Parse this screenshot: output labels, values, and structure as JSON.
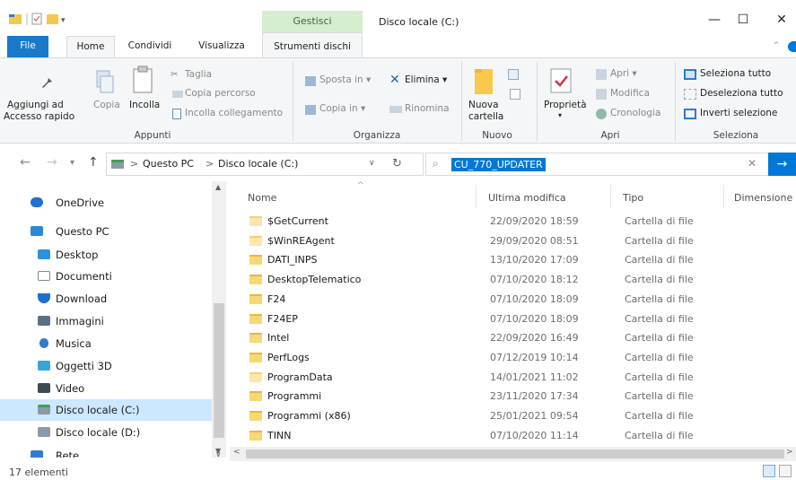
{
  "window": {
    "title": "Disco locale (C:)",
    "context_group": "Gestisci",
    "min_glyph": "—",
    "max_glyph": "☐",
    "close_glyph": "✕"
  },
  "tabs": [
    {
      "label": "File"
    },
    {
      "label": "Home"
    },
    {
      "label": "Condividi"
    },
    {
      "label": "Visualizza"
    },
    {
      "label": "Strumenti dischi"
    }
  ],
  "ribbon": {
    "appunti": {
      "pin_label_1": "Aggiungi ad",
      "pin_label_2": "Accesso rapido",
      "copy": "Copia",
      "paste": "Incolla",
      "cut": "Taglia",
      "copy_path": "Copia percorso",
      "paste_link": "Incolla collegamento",
      "group": "Appunti"
    },
    "organizza": {
      "move_to": "Sposta in ▾",
      "copy_to": "Copia in ▾",
      "delete": "Elimina ▾",
      "rename": "Rinomina",
      "group": "Organizza"
    },
    "nuovo": {
      "new_folder_1": "Nuova",
      "new_folder_2": "cartella",
      "group": "Nuovo"
    },
    "apri": {
      "properties": "Proprietà",
      "properties_arrow": "▾",
      "open": "Apri ▾",
      "edit": "Modifica",
      "history": "Cronologia",
      "group": "Apri"
    },
    "seleziona": {
      "select_all": "Seleziona tutto",
      "select_none": "Deseleziona tutto",
      "invert": "Inverti selezione",
      "group": "Seleziona"
    }
  },
  "address": {
    "segment_1": "Questo PC",
    "segment_2": "Disco locale (C:)",
    "separator": ">"
  },
  "search": {
    "value": "CU_770_UPDATER"
  },
  "nav": [
    {
      "label": "OneDrive",
      "color": "#1e6fd0"
    },
    {
      "label": "Questo PC",
      "color": "#2a8ad8"
    },
    {
      "label": "Desktop",
      "color": "#2f8fe0"
    },
    {
      "label": "Documenti",
      "color": "#7d8a96"
    },
    {
      "label": "Download",
      "color": "#1e6fd0"
    },
    {
      "label": "Immagini",
      "color": "#5a6f84"
    },
    {
      "label": "Musica",
      "color": "#2f7bd0"
    },
    {
      "label": "Oggetti 3D",
      "color": "#36a6d8"
    },
    {
      "label": "Video",
      "color": "#3d4a56"
    },
    {
      "label": "Disco locale (C:)",
      "color": "#8a9aa8"
    },
    {
      "label": "Disco locale (D:)",
      "color": "#8a9aa8"
    },
    {
      "label": "Rete",
      "color": "#2f7bd0"
    }
  ],
  "columns": {
    "name": "Nome",
    "modified": "Ultima modifica",
    "type": "Tipo",
    "size": "Dimensione"
  },
  "files": [
    {
      "name": "$GetCurrent",
      "date": "22/09/2020 18:59",
      "type": "Cartella di file",
      "light": true
    },
    {
      "name": "$WinREAgent",
      "date": "29/09/2020 08:51",
      "type": "Cartella di file",
      "light": true
    },
    {
      "name": "DATI_INPS",
      "date": "13/10/2020 17:09",
      "type": "Cartella di file",
      "light": false
    },
    {
      "name": "DesktopTelematico",
      "date": "07/10/2020 18:12",
      "type": "Cartella di file",
      "light": false
    },
    {
      "name": "F24",
      "date": "07/10/2020 18:09",
      "type": "Cartella di file",
      "light": false
    },
    {
      "name": "F24EP",
      "date": "07/10/2020 18:09",
      "type": "Cartella di file",
      "light": false
    },
    {
      "name": "Intel",
      "date": "22/09/2020 16:49",
      "type": "Cartella di file",
      "light": false
    },
    {
      "name": "PerfLogs",
      "date": "07/12/2019 10:14",
      "type": "Cartella di file",
      "light": false
    },
    {
      "name": "ProgramData",
      "date": "14/01/2021 11:02",
      "type": "Cartella di file",
      "light": true
    },
    {
      "name": "Programmi",
      "date": "23/11/2020 17:34",
      "type": "Cartella di file",
      "light": false
    },
    {
      "name": "Programmi (x86)",
      "date": "25/01/2021 09:54",
      "type": "Cartella di file",
      "light": false
    },
    {
      "name": "TINN",
      "date": "07/10/2020 11:14",
      "type": "Cartella di file",
      "light": false
    }
  ],
  "status": {
    "count": "17 elementi"
  },
  "colors": {
    "accent": "#0078d7",
    "file_tab": "#1979ca",
    "context_tab": "#d7edd0",
    "selected_nav": "#cce8ff"
  }
}
